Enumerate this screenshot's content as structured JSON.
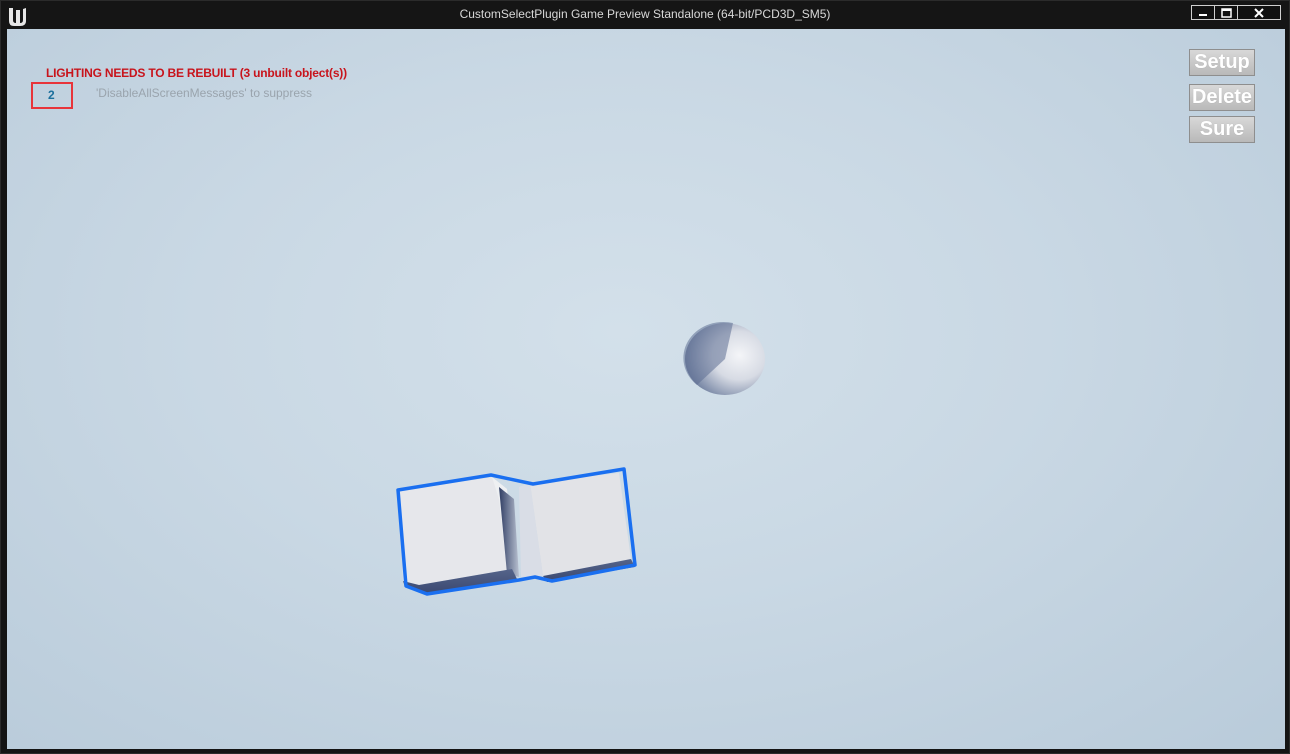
{
  "window": {
    "title": "CustomSelectPlugin Game Preview Standalone (64-bit/PCD3D_SM5)",
    "controls": {
      "minimize_icon": "minimize-icon",
      "maximize_icon": "maximize-icon",
      "close_icon": "close-icon"
    }
  },
  "overlay": {
    "lighting_message": "LIGHTING NEEDS TO BE REBUILT (3 unbuilt object(s))",
    "suppress_message": "'DisableAllScreenMessages' to suppress",
    "selection_count": "2"
  },
  "buttons": {
    "setup": "Setup",
    "delete": "Delete",
    "sure": "Sure"
  },
  "colors": {
    "selection_outline": "#1a6ff0",
    "warning_text": "#c8141c",
    "count_box_border": "#e8343a"
  }
}
